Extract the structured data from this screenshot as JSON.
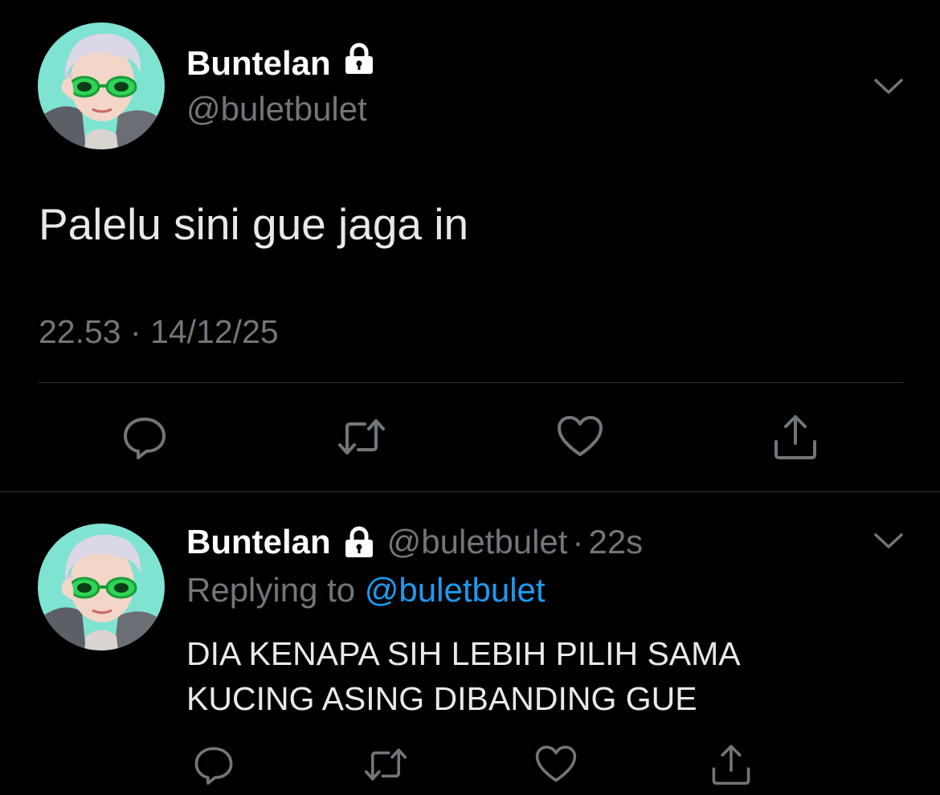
{
  "main_tweet": {
    "display_name": "Buntelan",
    "handle": "@buletbulet",
    "text": "Palelu sini gue jaga in",
    "time": "22.53",
    "separator": "·",
    "date": "14/12/25"
  },
  "reply_tweet": {
    "display_name": "Buntelan",
    "handle": "@buletbulet",
    "separator": "·",
    "age": "22s",
    "replying_prefix": "Replying to",
    "replying_to": "@buletbulet",
    "text_lines": [
      "DIA KENAPA SIH LEBIH PILIH SAMA",
      "KUCING ASING DIBANDING GUE"
    ]
  },
  "icons": {
    "protected": "lock-icon",
    "menu": "chevron-down-icon",
    "reply": "reply-icon",
    "retweet": "retweet-icon",
    "like": "heart-icon",
    "share": "share-icon"
  },
  "colors": {
    "background": "#000000",
    "text": "#e7e9ea",
    "secondary": "#71767b",
    "accent": "#1d9bf0",
    "divider": "#2f3336"
  }
}
